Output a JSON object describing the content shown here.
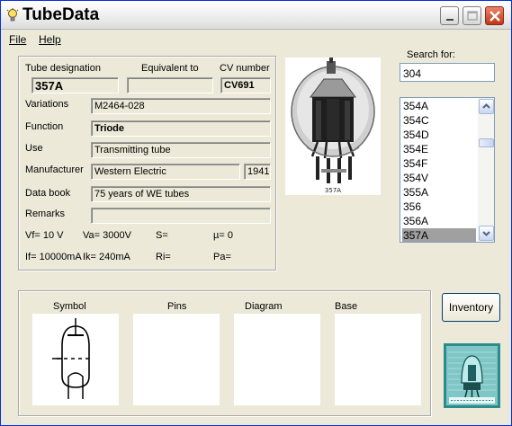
{
  "window": {
    "title": "TubeData"
  },
  "menu": {
    "file": "File",
    "help": "Help"
  },
  "tube": {
    "designation_label": "Tube designation",
    "designation": "357A",
    "equivalent_label": "Equivalent to",
    "equivalent": "",
    "cv_label": "CV number",
    "cv": "CV691",
    "variations_label": "Variations",
    "variations": "M2464-028",
    "function_label": "Function",
    "function": "Triode",
    "use_label": "Use",
    "use": "Transmitting tube",
    "manufacturer_label": "Manufacturer",
    "manufacturer": "Western Electric",
    "year": "1941",
    "databook_label": "Data book",
    "databook": "75 years of WE tubes",
    "remarks_label": "Remarks",
    "remarks": "",
    "vf": "Vf= 10 V",
    "va": "Va=  3000V",
    "s": "S=",
    "mu": "µ=    0",
    "if": "If= 10000mA",
    "ik": "Ik=   240mA",
    "ri": "Ri=",
    "pa": "Pa="
  },
  "photo_caption": "357A",
  "search": {
    "label": "Search for:",
    "value": "304"
  },
  "list": {
    "items": [
      "354A",
      "354C",
      "354D",
      "354E",
      "354F",
      "354V",
      "355A",
      "356",
      "356A",
      "357A"
    ],
    "selected": "357A"
  },
  "panels": {
    "symbol": "Symbol",
    "pins": "Pins",
    "diagram": "Diagram",
    "base": "Base"
  },
  "inventory_label": "Inventory",
  "colors": {
    "title_blue": "#0831d9",
    "close_red": "#c2361a",
    "face": "#ece9d8",
    "selection": "#a0a0a0"
  }
}
